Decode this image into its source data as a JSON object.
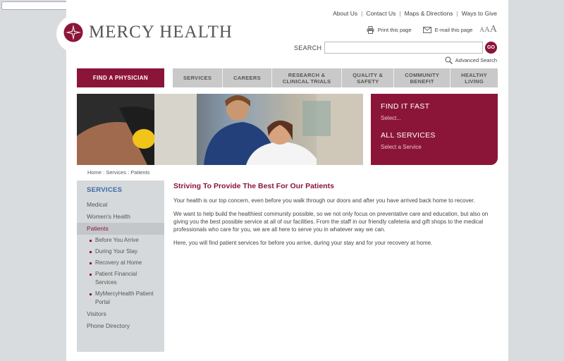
{
  "util_links": [
    "About Us",
    "Contact Us",
    "Maps & Directions",
    "Ways to Give"
  ],
  "tools": {
    "print": "Print this page",
    "email": "E-mail this page"
  },
  "text_size": {
    "small": "A",
    "medium": "A",
    "large": "A"
  },
  "logo": {
    "name": "MERCY HEALTH"
  },
  "search": {
    "label": "SEARCH",
    "placeholder": "",
    "go": "GO",
    "advanced": "Advanced Search"
  },
  "nav": {
    "find_physician": "FIND A PHYSICIAN",
    "items": [
      {
        "line1": "SERVICES",
        "line2": ""
      },
      {
        "line1": "CAREERS",
        "line2": ""
      },
      {
        "line1": "RESEARCH &",
        "line2": "CLINICAL TRIALS"
      },
      {
        "line1": "QUALITY &",
        "line2": "SAFETY"
      },
      {
        "line1": "COMMUNITY",
        "line2": "BENEFIT"
      },
      {
        "line1": "HEALTHY",
        "line2": "LIVING"
      }
    ]
  },
  "find_box": {
    "find_title": "FIND IT FAST",
    "find_select": "Select...",
    "services_title": "ALL SERVICES",
    "services_select": "Select a Service"
  },
  "breadcrumb": "Home :  Services :  Patients",
  "sidebar": {
    "title": "SERVICES",
    "items": [
      "Medical",
      "Women's Health",
      "Patients"
    ],
    "subitems": [
      "Before You Arrive",
      "During Your Stay",
      "Recovery at Home",
      "Patient Financial Services",
      "MyMercyHealth Patient Portal"
    ],
    "bottom_items": [
      "Visitors",
      "Phone Directory"
    ]
  },
  "content": {
    "heading": "Striving To Provide The Best For Our Patients",
    "paragraphs": [
      "Your health is our top concern, even before you walk through our doors and after you have arrived back home to recover.",
      "We want to help build the healthiest community possible, so we not only focus on preventative care and education, but also on giving you the best possible service at all of our facilities. From the staff in our friendly cafeteria and gift shops to the medical professionals who care for you, we are all here to serve you in whatever way we can.",
      "Here, you will find patient services for before you arrive, during your stay and for your recovery at home."
    ]
  },
  "colors": {
    "brand": "#8b1538",
    "sidebar_title": "#3a6aa5"
  }
}
